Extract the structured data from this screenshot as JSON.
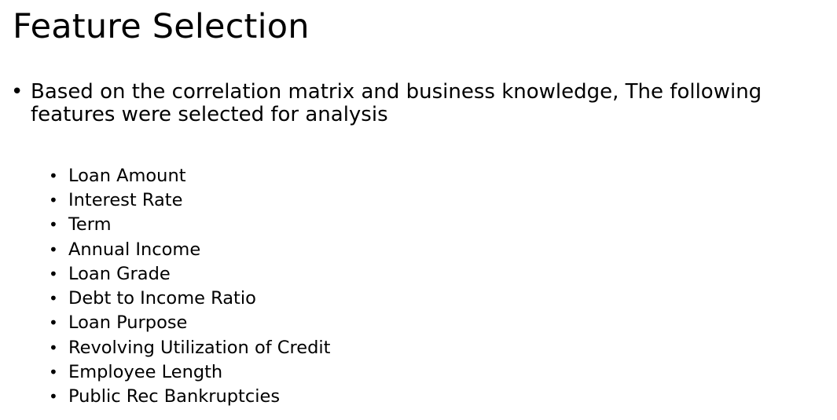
{
  "slide": {
    "title": "Feature Selection",
    "lead_text": "Based on the correlation matrix and business knowledge, The following features were selected for analysis",
    "bullet_glyph": "•",
    "features": [
      "Loan Amount",
      "Interest Rate",
      "Term",
      "Annual Income",
      "Loan Grade",
      "Debt to Income Ratio",
      "Loan Purpose",
      "Revolving Utilization of Credit",
      "Employee Length",
      "Public Rec Bankruptcies"
    ]
  }
}
